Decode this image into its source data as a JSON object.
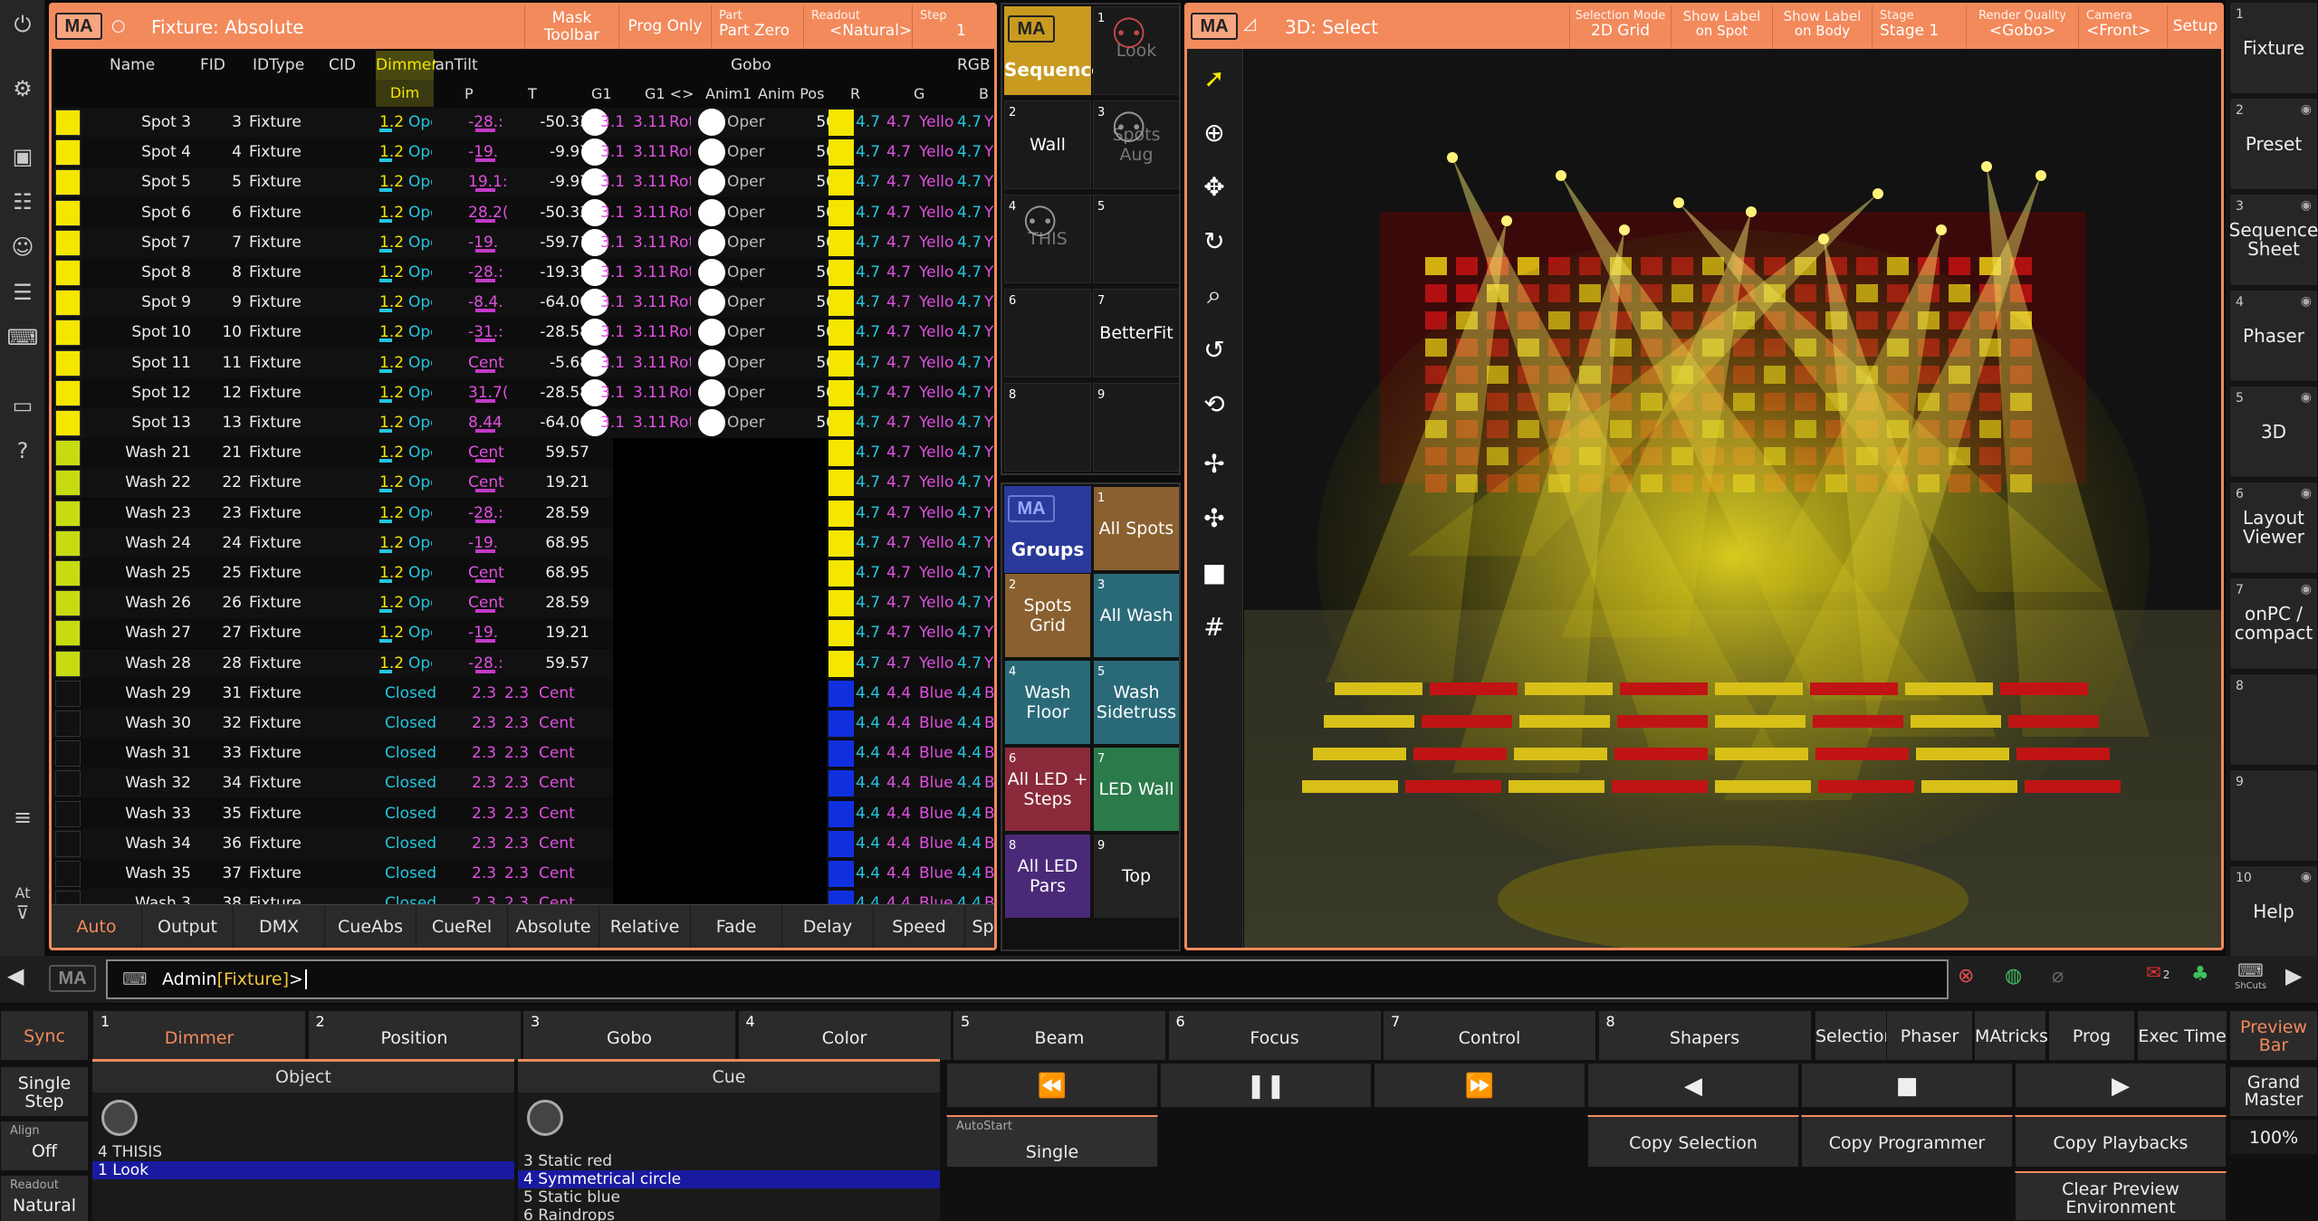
{
  "left_rail": {
    "icons": [
      "power-icon",
      "settings-icon",
      "store-icon",
      "faders-icon",
      "user-icon",
      "mixer-icon",
      "keyboard-icon",
      "monitor-icon",
      "help-icon",
      "list-icon",
      "filter-icon"
    ],
    "at_label": "At"
  },
  "fixture_sheet": {
    "title": "Fixture: Absolute",
    "buttons": [
      {
        "label": "Mask",
        "label2": "Toolbar"
      },
      {
        "label": "Prog Only",
        "label2": ""
      },
      {
        "small": "Part",
        "label": "Part Zero"
      },
      {
        "small": "Readout",
        "label": "<Natural>"
      },
      {
        "small": "Step",
        "label": "1"
      }
    ],
    "headers": {
      "name": "Name",
      "fid": "FID",
      "idtype": "IDType",
      "cid": "CID",
      "dimmer": "Dimmer",
      "pantilt": "PanTilt",
      "gobo": "Gobo",
      "rgb": "RGB"
    },
    "subheaders": {
      "dim": "Dim",
      "p": "P",
      "t": "T",
      "g1": "G1",
      "g1rot": "G1 <>",
      "anim1": "Anim1",
      "animpos": "Anim Pos",
      "r": "R",
      "g": "G",
      "b": "B"
    },
    "rows": [
      {
        "name": "Spot 3",
        "fid": "3",
        "type": "Fixture",
        "color": "#f5e600",
        "dim": "1.2",
        "shutter": "Ope",
        "p": "-28.:",
        "t": "-50.33",
        "g1": "3.1",
        "rot": "3.11",
        "rotname": "Rot",
        "anim": "Oper",
        "apos": "50",
        "r": "4.7",
        "g": "4.7",
        "cname": "Yello",
        "b": "4.7",
        "bc": "Y",
        "kind": "spot"
      },
      {
        "name": "Spot 4",
        "fid": "4",
        "type": "Fixture",
        "color": "#f5e600",
        "dim": "1.2",
        "shutter": "Ope",
        "p": "-19.",
        "t": "-9.97",
        "g1": "3.1",
        "rot": "3.11",
        "rotname": "Rot",
        "anim": "Oper",
        "apos": "50",
        "r": "4.7",
        "g": "4.7",
        "cname": "Yello",
        "b": "4.7",
        "bc": "Y",
        "kind": "spot"
      },
      {
        "name": "Spot 5",
        "fid": "5",
        "type": "Fixture",
        "color": "#f5e600",
        "dim": "1.2",
        "shutter": "Ope",
        "p": "19.1:",
        "t": "-9.97",
        "g1": "3.1",
        "rot": "3.11",
        "rotname": "Rot",
        "anim": "Oper",
        "apos": "50",
        "r": "4.7",
        "g": "4.7",
        "cname": "Yello",
        "b": "4.7",
        "bc": "Y",
        "kind": "spot"
      },
      {
        "name": "Spot 6",
        "fid": "6",
        "type": "Fixture",
        "color": "#f5e600",
        "dim": "1.2",
        "shutter": "Ope",
        "p": "28.2(",
        "t": "-50.33",
        "g1": "3.1",
        "rot": "3.11",
        "rotname": "Rot",
        "anim": "Oper",
        "apos": "50",
        "r": "4.7",
        "g": "4.7",
        "cname": "Yello",
        "b": "4.7",
        "bc": "Y",
        "kind": "spot"
      },
      {
        "name": "Spot 7",
        "fid": "7",
        "type": "Fixture",
        "color": "#f5e600",
        "dim": "1.2",
        "shutter": "Ope",
        "p": "-19.",
        "t": "-59.71",
        "g1": "3.1",
        "rot": "3.11",
        "rotname": "Rot",
        "anim": "Oper",
        "apos": "50",
        "r": "4.7",
        "g": "4.7",
        "cname": "Yello",
        "b": "4.7",
        "bc": "Y",
        "kind": "spot"
      },
      {
        "name": "Spot 8",
        "fid": "8",
        "type": "Fixture",
        "color": "#f5e600",
        "dim": "1.2",
        "shutter": "Ope",
        "p": "-28.:",
        "t": "-19.35",
        "g1": "3.1",
        "rot": "3.11",
        "rotname": "Rot",
        "anim": "Oper",
        "apos": "50",
        "r": "4.7",
        "g": "4.7",
        "cname": "Yello",
        "b": "4.7",
        "bc": "Y",
        "kind": "spot"
      },
      {
        "name": "Spot 9",
        "fid": "9",
        "type": "Fixture",
        "color": "#f5e600",
        "dim": "1.2",
        "shutter": "Ope",
        "p": "-8.4.",
        "t": "-64.00",
        "g1": "3.1",
        "rot": "3.11",
        "rotname": "Rot",
        "anim": "Oper",
        "apos": "50",
        "r": "4.7",
        "g": "4.7",
        "cname": "Yello",
        "b": "4.7",
        "bc": "Y",
        "kind": "spot"
      },
      {
        "name": "Spot 10",
        "fid": "10",
        "type": "Fixture",
        "color": "#f5e600",
        "dim": "1.2",
        "shutter": "Ope",
        "p": "-31.:",
        "t": "-28.58",
        "g1": "3.1",
        "rot": "3.11",
        "rotname": "Rot",
        "anim": "Oper",
        "apos": "50",
        "r": "4.7",
        "g": "4.7",
        "cname": "Yello",
        "b": "4.7",
        "bc": "Y",
        "kind": "spot"
      },
      {
        "name": "Spot 11",
        "fid": "11",
        "type": "Fixture",
        "color": "#f5e600",
        "dim": "1.2",
        "shutter": "Ope",
        "p": "Cent",
        "t": "-5.68",
        "g1": "3.1",
        "rot": "3.11",
        "rotname": "Rot",
        "anim": "Oper",
        "apos": "50",
        "r": "4.7",
        "g": "4.7",
        "cname": "Yello",
        "b": "4.7",
        "bc": "Y",
        "kind": "spot"
      },
      {
        "name": "Spot 12",
        "fid": "12",
        "type": "Fixture",
        "color": "#f5e600",
        "dim": "1.2",
        "shutter": "Ope",
        "p": "31.7(",
        "t": "-28.58",
        "g1": "3.1",
        "rot": "3.11",
        "rotname": "Rot",
        "anim": "Oper",
        "apos": "50",
        "r": "4.7",
        "g": "4.7",
        "cname": "Yello",
        "b": "4.7",
        "bc": "Y",
        "kind": "spot"
      },
      {
        "name": "Spot 13",
        "fid": "13",
        "type": "Fixture",
        "color": "#f5e600",
        "dim": "1.2",
        "shutter": "Ope",
        "p": "8.44",
        "t": "-64.00",
        "g1": "3.1",
        "rot": "3.11",
        "rotname": "Rot",
        "anim": "Oper",
        "apos": "50",
        "r": "4.7",
        "g": "4.7",
        "cname": "Yello",
        "b": "4.7",
        "bc": "Y",
        "kind": "spot"
      },
      {
        "name": "Wash 21",
        "fid": "21",
        "type": "Fixture",
        "color": "#c7dc10",
        "dim": "1.2",
        "shutter": "Ope",
        "p": "Cent",
        "t": "59.57",
        "r": "4.7",
        "g": "4.7",
        "cname": "Yello",
        "b": "4.7",
        "bc": "Y",
        "kind": "wash"
      },
      {
        "name": "Wash 22",
        "fid": "22",
        "type": "Fixture",
        "color": "#c7dc10",
        "dim": "1.2",
        "shutter": "Ope",
        "p": "Cent",
        "t": "19.21",
        "r": "4.7",
        "g": "4.7",
        "cname": "Yello",
        "b": "4.7",
        "bc": "Y",
        "kind": "wash"
      },
      {
        "name": "Wash 23",
        "fid": "23",
        "type": "Fixture",
        "color": "#c7dc10",
        "dim": "1.2",
        "shutter": "Ope",
        "p": "-28.:",
        "t": "28.59",
        "r": "4.7",
        "g": "4.7",
        "cname": "Yello",
        "b": "4.7",
        "bc": "Y",
        "kind": "wash"
      },
      {
        "name": "Wash 24",
        "fid": "24",
        "type": "Fixture",
        "color": "#c7dc10",
        "dim": "1.2",
        "shutter": "Ope",
        "p": "-19.",
        "t": "68.95",
        "r": "4.7",
        "g": "4.7",
        "cname": "Yello",
        "b": "4.7",
        "bc": "Y",
        "kind": "wash"
      },
      {
        "name": "Wash 25",
        "fid": "25",
        "type": "Fixture",
        "color": "#c7dc10",
        "dim": "1.2",
        "shutter": "Ope",
        "p": "Cent",
        "t": "68.95",
        "r": "4.7",
        "g": "4.7",
        "cname": "Yello",
        "b": "4.7",
        "bc": "Y",
        "kind": "wash"
      },
      {
        "name": "Wash 26",
        "fid": "26",
        "type": "Fixture",
        "color": "#c7dc10",
        "dim": "1.2",
        "shutter": "Ope",
        "p": "Cent",
        "t": "28.59",
        "r": "4.7",
        "g": "4.7",
        "cname": "Yello",
        "b": "4.7",
        "bc": "Y",
        "kind": "wash"
      },
      {
        "name": "Wash 27",
        "fid": "27",
        "type": "Fixture",
        "color": "#c7dc10",
        "dim": "1.2",
        "shutter": "Ope",
        "p": "-19.",
        "t": "19.21",
        "r": "4.7",
        "g": "4.7",
        "cname": "Yello",
        "b": "4.7",
        "bc": "Y",
        "kind": "wash"
      },
      {
        "name": "Wash 28",
        "fid": "28",
        "type": "Fixture",
        "color": "#c7dc10",
        "dim": "1.2",
        "shutter": "Ope",
        "p": "-28.:",
        "t": "59.57",
        "r": "4.7",
        "g": "4.7",
        "cname": "Yello",
        "b": "4.7",
        "bc": "Y",
        "kind": "wash"
      },
      {
        "name": "Wash 29",
        "fid": "31",
        "type": "Fixture",
        "color": "#111111",
        "shutter": "Closed",
        "p": "2.3",
        "t": "2.3",
        "tname": "Cent",
        "r": "4.4",
        "g": "4.4",
        "cname": "Blue",
        "b": "4.4",
        "bc": "B",
        "kind": "led"
      },
      {
        "name": "Wash 30",
        "fid": "32",
        "type": "Fixture",
        "color": "#111111",
        "shutter": "Closed",
        "p": "2.3",
        "t": "2.3",
        "tname": "Cent",
        "r": "4.4",
        "g": "4.4",
        "cname": "Blue",
        "b": "4.4",
        "bc": "B",
        "kind": "led"
      },
      {
        "name": "Wash 31",
        "fid": "33",
        "type": "Fixture",
        "color": "#111111",
        "shutter": "Closed",
        "p": "2.3",
        "t": "2.3",
        "tname": "Cent",
        "r": "4.4",
        "g": "4.4",
        "cname": "Blue",
        "b": "4.4",
        "bc": "B",
        "kind": "led"
      },
      {
        "name": "Wash 32",
        "fid": "34",
        "type": "Fixture",
        "color": "#111111",
        "shutter": "Closed",
        "p": "2.3",
        "t": "2.3",
        "tname": "Cent",
        "r": "4.4",
        "g": "4.4",
        "cname": "Blue",
        "b": "4.4",
        "bc": "B",
        "kind": "led"
      },
      {
        "name": "Wash 33",
        "fid": "35",
        "type": "Fixture",
        "color": "#111111",
        "shutter": "Closed",
        "p": "2.3",
        "t": "2.3",
        "tname": "Cent",
        "r": "4.4",
        "g": "4.4",
        "cname": "Blue",
        "b": "4.4",
        "bc": "B",
        "kind": "led"
      },
      {
        "name": "Wash 34",
        "fid": "36",
        "type": "Fixture",
        "color": "#111111",
        "shutter": "Closed",
        "p": "2.3",
        "t": "2.3",
        "tname": "Cent",
        "r": "4.4",
        "g": "4.4",
        "cname": "Blue",
        "b": "4.4",
        "bc": "B",
        "kind": "led"
      },
      {
        "name": "Wash 35",
        "fid": "37",
        "type": "Fixture",
        "color": "#111111",
        "shutter": "Closed",
        "p": "2.3",
        "t": "2.3",
        "tname": "Cent",
        "r": "4.4",
        "g": "4.4",
        "cname": "Blue",
        "b": "4.4",
        "bc": "B",
        "kind": "led"
      },
      {
        "name": "Wash 3",
        "fid": "38",
        "type": "Fixture",
        "color": "#111111",
        "shutter": "Closed",
        "p": "2.3",
        "t": "2.3",
        "tname": "Cent",
        "r": "4.4",
        "g": "4.4",
        "cname": "Blue",
        "b": "4.4",
        "bc": "B",
        "kind": "led"
      }
    ],
    "tabs": [
      "Auto",
      "Output",
      "DMX",
      "CueAbs",
      "CueRel",
      "Absolute",
      "Relative",
      "Fade",
      "Delay",
      "Speed",
      "Sp"
    ],
    "active_tab": "Auto"
  },
  "sequence_pool": {
    "title": "Sequence",
    "items": [
      {
        "n": "1",
        "label": "Look"
      },
      {
        "n": "2",
        "label": "Wall"
      },
      {
        "n": "3",
        "label": "Spots Aug"
      },
      {
        "n": "4",
        "label": "THIS"
      },
      {
        "n": "5",
        "label": ""
      },
      {
        "n": "6",
        "label": ""
      },
      {
        "n": "7",
        "label": "BetterFit"
      },
      {
        "n": "8",
        "label": ""
      },
      {
        "n": "9",
        "label": ""
      }
    ]
  },
  "groups_pool": {
    "title": "Groups",
    "items": [
      {
        "n": "1",
        "label": "All Spots",
        "color": "#8a6030"
      },
      {
        "n": "2",
        "label": "Spots Grid",
        "color": "#8a6030"
      },
      {
        "n": "3",
        "label": "All Wash",
        "color": "#2a6a78"
      },
      {
        "n": "4",
        "label": "Wash Floor",
        "color": "#2a6a78"
      },
      {
        "n": "5",
        "label": "Wash Sidetruss",
        "color": "#2a6a78"
      },
      {
        "n": "6",
        "label": "All LED + Steps",
        "color": "#8a2a3a"
      },
      {
        "n": "7",
        "label": "LED Wall",
        "color": "#2a7a4a"
      },
      {
        "n": "8",
        "label": "All LED Pars",
        "color": "#4a2a78"
      },
      {
        "n": "9",
        "label": "Top",
        "color": "#222222"
      }
    ]
  },
  "view3d": {
    "title": "3D: Select",
    "buttons": [
      {
        "small": "Selection Mode",
        "label": "2D Grid"
      },
      {
        "small": "Show Label",
        "label": "on Spot"
      },
      {
        "small": "Show Label",
        "label": "on Body"
      },
      {
        "small": "Stage",
        "label": "Stage 1"
      },
      {
        "small": "Render Quality",
        "label": "<Gobo>"
      },
      {
        "small": "Camera",
        "label": "<Front>"
      },
      {
        "small": "",
        "label": "Setup"
      }
    ],
    "tools": [
      "select-arrow-icon",
      "target-icon",
      "move-icon",
      "rotate-icon",
      "zoom-icon",
      "orbit-icon",
      "reset-orbit-icon",
      "pan-icon",
      "fit-icon",
      "camera-icon",
      "grid-icon"
    ]
  },
  "right_bar": [
    {
      "n": "1",
      "label": "Fixture"
    },
    {
      "n": "2",
      "label": "Preset"
    },
    {
      "n": "3",
      "label": "Sequence Sheet"
    },
    {
      "n": "4",
      "label": "Phaser"
    },
    {
      "n": "5",
      "label": "3D"
    },
    {
      "n": "6",
      "label": "Layout Viewer"
    },
    {
      "n": "7",
      "label": "onPC / compact"
    },
    {
      "n": "8",
      "label": ""
    },
    {
      "n": "9",
      "label": ""
    },
    {
      "n": "10",
      "label": "Help"
    }
  ],
  "command_line": {
    "user": "Admin",
    "target": "[Fixture]",
    "prompt": ">"
  },
  "presets": [
    {
      "n": "1",
      "label": "Dimmer"
    },
    {
      "n": "2",
      "label": "Position"
    },
    {
      "n": "3",
      "label": "Gobo"
    },
    {
      "n": "4",
      "label": "Color"
    },
    {
      "n": "5",
      "label": "Beam"
    },
    {
      "n": "6",
      "label": "Focus"
    },
    {
      "n": "7",
      "label": "Control"
    },
    {
      "n": "8",
      "label": "Shapers"
    }
  ],
  "preset_extra": [
    "Selection",
    "Phaser",
    "MAtricks",
    "Prog Time",
    "Exec Time"
  ],
  "preview_bar": "Preview Bar",
  "left_bottom": {
    "sync": "Sync",
    "single_step": "Single Step",
    "align_label": "Align",
    "align_value": "Off",
    "readout_label": "Readout",
    "readout_value": "Natural"
  },
  "object_panel": {
    "title": "Object",
    "lines": [
      {
        "text": "4  THISIS",
        "selected": false
      },
      {
        "text": "1  Look",
        "selected": true
      }
    ]
  },
  "cue_panel": {
    "title": "Cue",
    "lines": [
      {
        "text": "3  Static  red",
        "selected": false
      },
      {
        "text": "4  Symmetrical  circle",
        "selected": true
      },
      {
        "text": "5  Static  blue",
        "selected": false
      },
      {
        "text": "6  Raindrops",
        "selected": false
      }
    ]
  },
  "playback": {
    "autostart_label": "AutoStart",
    "autostart_value": "Single"
  },
  "actions": [
    "Copy Selection",
    "Copy Programmer",
    "Copy Playbacks",
    "Clear Preview Environment"
  ],
  "grand_master": {
    "label": "Grand Master",
    "value": "100%"
  },
  "status": {
    "mail_count": "2",
    "shortcuts": "ShCuts"
  }
}
